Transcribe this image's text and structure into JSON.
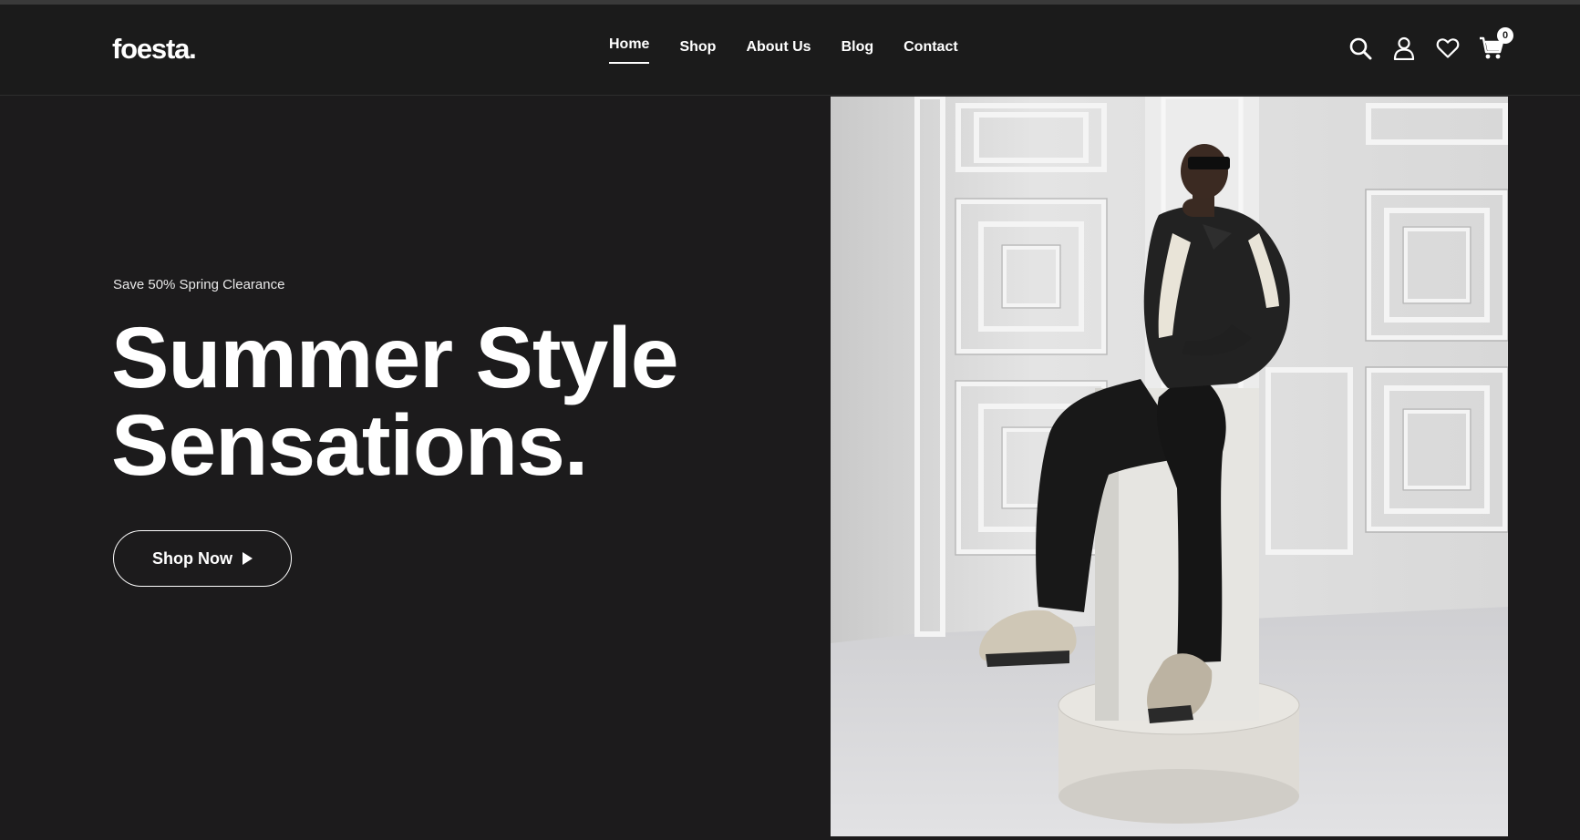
{
  "header": {
    "logo": "foesta.",
    "nav": [
      {
        "label": "Home",
        "active": true
      },
      {
        "label": "Shop",
        "active": false
      },
      {
        "label": "About Us",
        "active": false
      },
      {
        "label": "Blog",
        "active": false
      },
      {
        "label": "Contact",
        "active": false
      }
    ],
    "icons": [
      "search-icon",
      "user-icon",
      "heart-icon",
      "cart-icon"
    ],
    "cart_count": "0"
  },
  "hero": {
    "subtitle": "Save 50% Spring Clearance",
    "title_line1": "Summer Style",
    "title_line2": "Sensations.",
    "cta_label": "Shop Now"
  },
  "colors": {
    "background": "#1c1b1c",
    "text": "#ffffff",
    "photo_wall": "#e6e6e6"
  }
}
